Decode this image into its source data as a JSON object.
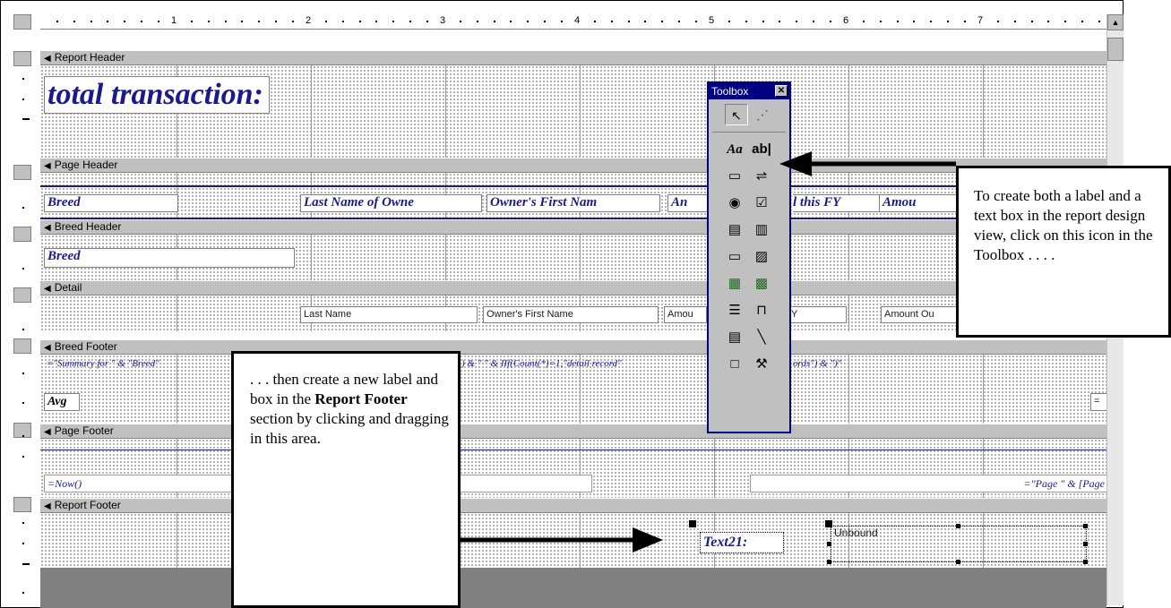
{
  "ruler": {
    "numbers": [
      "1",
      "2",
      "3",
      "4",
      "5",
      "6",
      "7"
    ]
  },
  "sections": {
    "report_header": "Report Header",
    "page_header": "Page Header",
    "breed_header": "Breed Header",
    "detail": "Detail",
    "breed_footer": "Breed Footer",
    "page_footer": "Page Footer",
    "report_footer": "Report Footer"
  },
  "report_header": {
    "title": "total transaction:"
  },
  "page_header": {
    "breed": "Breed",
    "last_name": "Last Name of Owne",
    "first_name": "Owner's First Nam",
    "amount_partial": "An",
    "paid_fy": "l this FY",
    "amount2": "Amou"
  },
  "breed_header": {
    "breed": "Breed"
  },
  "detail": {
    "last_name": "Last Name",
    "first_name": "Owner's First Name",
    "amount": "Amou",
    "amount_partial2": "Y",
    "amount_out": "Amount Ou"
  },
  "breed_footer": {
    "summary_left": "=\"Summary for \" & \"Breed\"",
    "summary_right": ") & \" \" & IIf(Count(*)=1,\"detail record\"",
    "summary_end": "ords\") & \")\"",
    "avg": "Avg",
    "right_expr": "="
  },
  "page_footer": {
    "now": "=Now()",
    "page": "=\"Page \" & [Page"
  },
  "report_footer": {
    "text_label": "Text21:",
    "unbound": "Unbound"
  },
  "toolbox": {
    "title": "Toolbox",
    "close": "✕",
    "label_tool": "Aa",
    "textbox_tool": "ab|"
  },
  "callouts": {
    "right": "To create both a label and a text box in the report design view, click on this icon in the Toolbox . . . .",
    "bottom_parts": {
      "intro": " . . . then create a new label and box in the ",
      "bold1": "Report Footer",
      "rest": " section by clicking and dragging in this area."
    }
  },
  "colors": {
    "section_bar": "#c0c0c0",
    "toolbox_title": "#000080",
    "label_text": "#1a1a8c",
    "grey_fill": "#808080"
  }
}
